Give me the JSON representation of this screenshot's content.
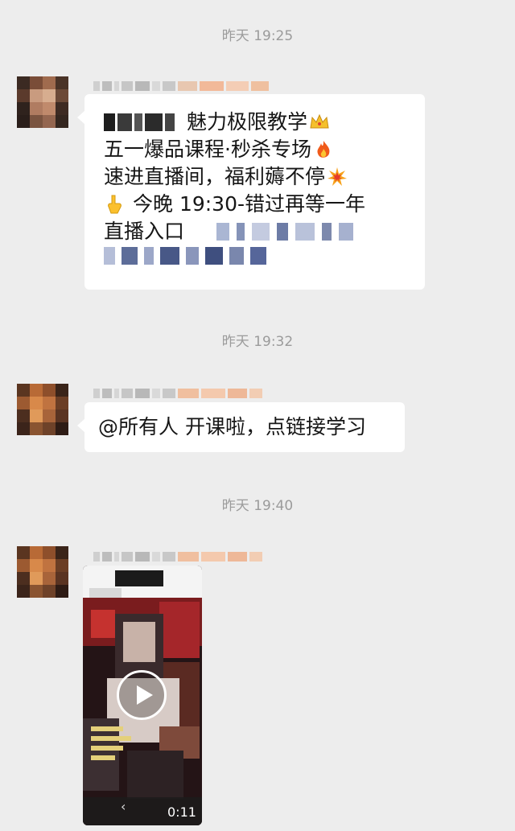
{
  "timestamps": [
    "昨天 19:25",
    "昨天 19:32",
    "昨天 19:40"
  ],
  "message1": {
    "lines": [
      "魅力极限教学",
      "五一爆品课程·秒杀专场",
      "速进直播间，福利薅不停",
      "今晚 19:30-错过再等一年",
      "直播入口"
    ],
    "emojis": [
      "crown-emoji",
      "fire-emoji",
      "collision-emoji",
      "pointing-down-emoji"
    ]
  },
  "message2": {
    "text": "@所有人 开课啦，点链接学习"
  },
  "message3": {
    "video_duration": "0:11",
    "back_glyph": "‹"
  },
  "colors": {
    "background": "#ededed",
    "bubble": "#ffffff",
    "timestamp": "#9b9b9b"
  }
}
